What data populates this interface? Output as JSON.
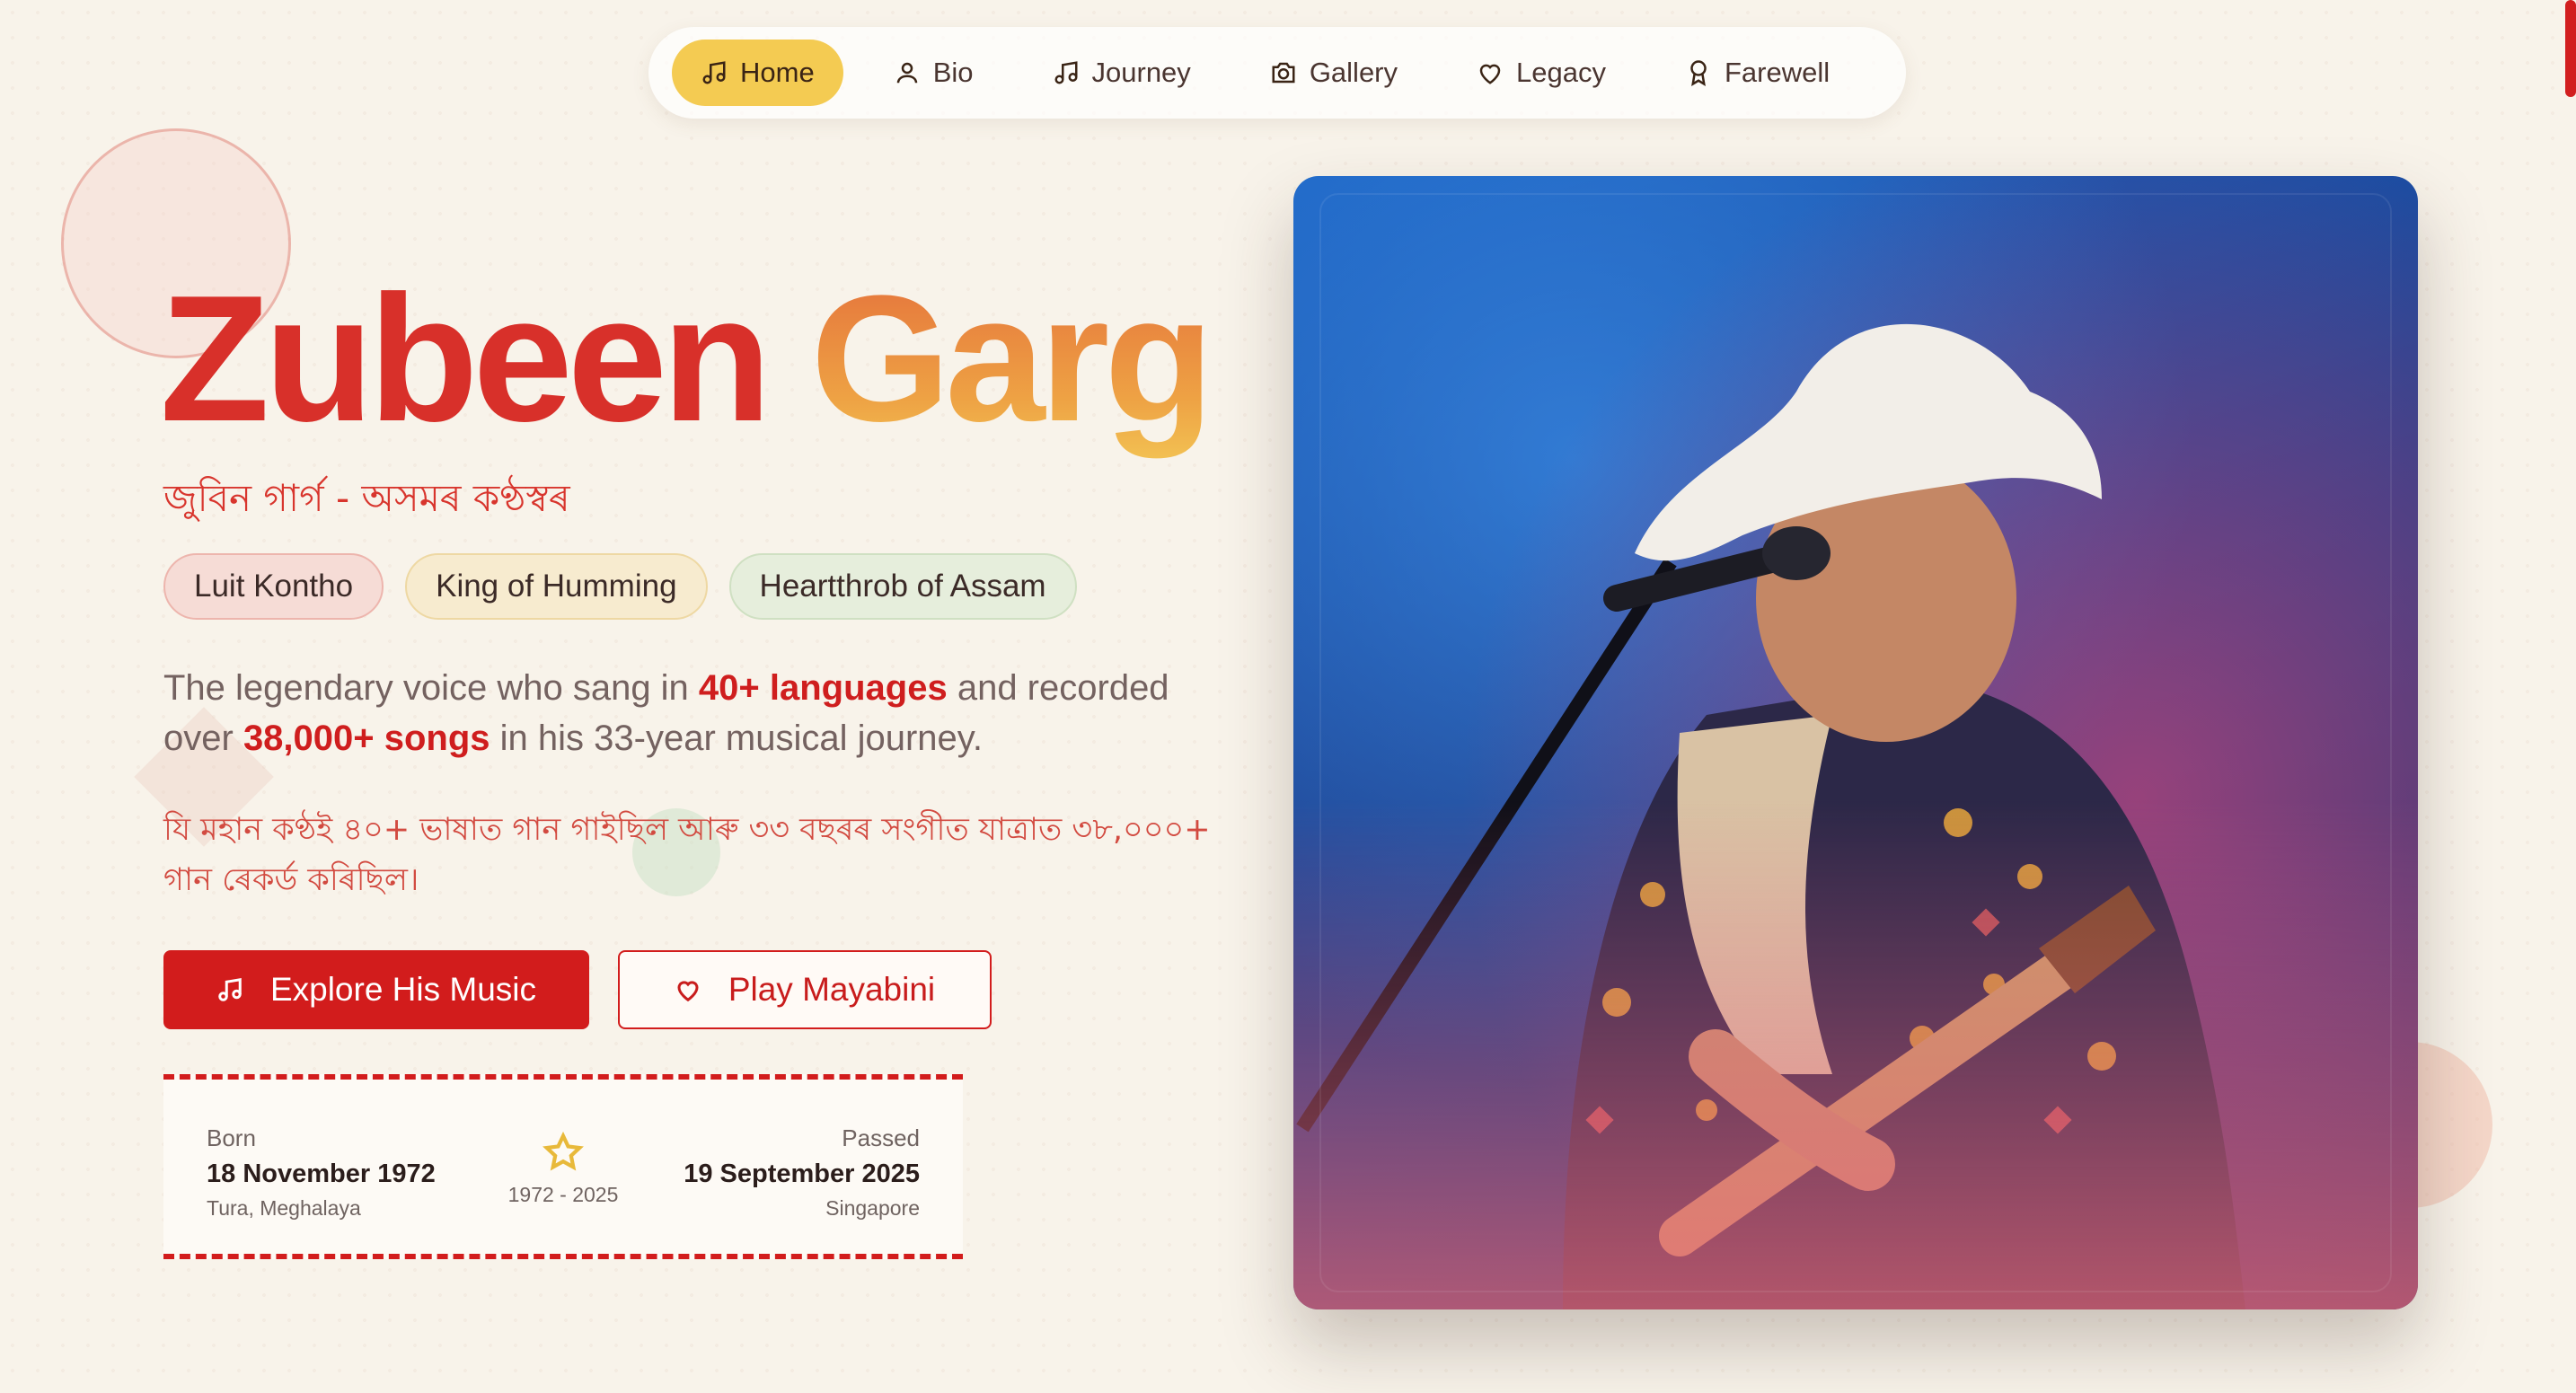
{
  "nav": {
    "items": [
      {
        "label": "Home",
        "icon": "music-note-icon",
        "active": true
      },
      {
        "label": "Bio",
        "icon": "user-icon",
        "active": false
      },
      {
        "label": "Journey",
        "icon": "music-note-icon",
        "active": false
      },
      {
        "label": "Gallery",
        "icon": "camera-icon",
        "active": false
      },
      {
        "label": "Legacy",
        "icon": "heart-icon",
        "active": false
      },
      {
        "label": "Farewell",
        "icon": "award-icon",
        "active": false
      }
    ]
  },
  "hero": {
    "first_name": "Zubeen",
    "last_name": "Garg",
    "subtitle": "জুবিন গাৰ্গ - অসমৰ কণ্ঠস্বৰ",
    "badges": [
      "Luit Kontho",
      "King of Humming",
      "Heartthrob of Assam"
    ],
    "description": {
      "part1": "The legendary voice who sang in ",
      "highlight1": "40+ languages",
      "part2": " and recorded over ",
      "highlight2": "38,000+ songs",
      "part3": " in his 33-year musical journey."
    },
    "description_assamese": "যি মহান কণ্ঠই ৪০+ ভাষাত গান গাইছিল আৰু ৩৩ বছৰৰ সংগীত যাত্ৰাত ৩৮,০০০+ গান ৰেকৰ্ড কৰিছিল।",
    "primary_button": {
      "label": "Explore His Music",
      "icon": "music-note-icon"
    },
    "secondary_button": {
      "label": "Play Mayabini",
      "icon": "heart-icon"
    }
  },
  "dates": {
    "born_label": "Born",
    "born_date": "18 November 1972",
    "born_place": "Tura, Meghalaya",
    "range": "1972 - 2025",
    "range_icon": "star-icon",
    "passed_label": "Passed",
    "passed_date": "19 September 2025",
    "passed_place": "Singapore"
  },
  "colors": {
    "accent_red": "#d21c1c",
    "accent_yellow": "#f4cb52",
    "background": "#f8f3ea"
  }
}
